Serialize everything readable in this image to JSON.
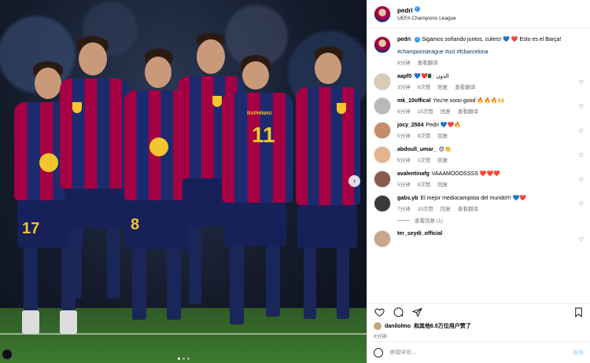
{
  "post": {
    "author": "pedri",
    "location": "UEFA Champions League",
    "caption_text": "Sigamos soñando juntos, culers! 💙 ❤️ Esto es el Barça!",
    "hashtags": "#championsleague #ucl #fcbarcelona",
    "time": "8分钟",
    "translate": "查看翻译",
    "likes_user": "danilolmo",
    "likes_rest": "和其他6.5万位用户赞了",
    "likes_time": "8分钟",
    "composer_placeholder": "添加评论...",
    "post_button": "发布"
  },
  "comments": [
    {
      "user": "aapf0",
      "text": "💙❤️🇩🇿 الذون",
      "time": "3分钟",
      "likes": "6次赞",
      "reply": "回复",
      "translate": "查看翻译",
      "color": "#d9c9b6"
    },
    {
      "user": "mk_10offical",
      "text": "You're sooo good 🔥🔥🔥🙌",
      "time": "6分钟",
      "likes": "15次赞",
      "reply": "回复",
      "translate": "查看翻译",
      "color": "#b8b8b8"
    },
    {
      "user": "jocy_2504",
      "text": "Pedri 💙❤️🔥",
      "time": "5分钟",
      "likes": "9次赞",
      "reply": "回复",
      "translate": "",
      "color": "#c58c6a"
    },
    {
      "user": "abdoull_umar_",
      "text": "😍👏",
      "time": "5分钟",
      "likes": "1次赞",
      "reply": "回复",
      "translate": "",
      "color": "#e3b58e"
    },
    {
      "user": "avalentinafg",
      "text": "VAAAMOOOSSSS ❤️❤️❤️",
      "time": "5分钟",
      "likes": "9次赞",
      "reply": "回复",
      "translate": "",
      "color": "#8a5a4a"
    },
    {
      "user": "gabs.yb",
      "text": "El mejor mediocampista del mundo!!! 💙❤️",
      "time": "7分钟",
      "likes": "33次赞",
      "reply": "回复",
      "translate": "查看翻译",
      "color": "#3a3a3a"
    },
    {
      "user": "ter_seydi_official",
      "text": "",
      "time": "",
      "likes": "",
      "reply": "",
      "translate": "",
      "color": "#c9a58c"
    }
  ],
  "view_replies": "查看回复 (1)",
  "photo": {
    "numbers": [
      "17",
      "8",
      "11"
    ],
    "captain_name": "RAPHINHA"
  },
  "colors": {
    "barca_red": "#a50044",
    "barca_blue": "#1c2b6e",
    "gold": "#f4c530",
    "link": "#00376b",
    "meta": "#737373"
  },
  "icons": [
    "verified-icon",
    "heart-icon",
    "comment-icon",
    "share-icon",
    "bookmark-icon",
    "emoji-icon",
    "chevron-right-icon"
  ]
}
